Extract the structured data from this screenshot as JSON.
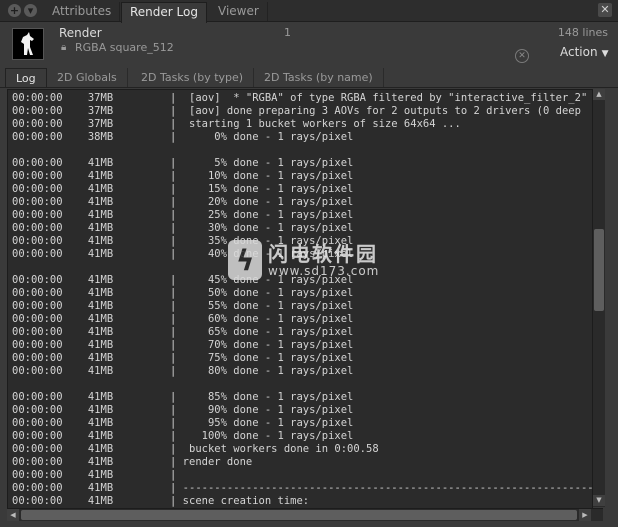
{
  "window": {
    "tabs": [
      {
        "label": "Attributes",
        "active": false
      },
      {
        "label": "Render Log",
        "active": true
      },
      {
        "label": "Viewer",
        "active": false
      }
    ]
  },
  "header": {
    "title": "Render",
    "pass_name": "RGBA  square_512",
    "frame": "1",
    "line_count": "148 lines",
    "action_label": "Action"
  },
  "subtabs": [
    {
      "label": "Log",
      "active": true
    },
    {
      "label": "2D Globals",
      "active": false
    },
    {
      "label": "2D Tasks (by type)",
      "active": false
    },
    {
      "label": "2D Tasks (by name)",
      "active": false
    }
  ],
  "log_lines": [
    "00:00:00    37MB         |  [aov]  * \"RGBA\" of type RGBA filtered by \"interactive_filter_2\"",
    "00:00:00    37MB         |  [aov] done preparing 3 AOVs for 2 outputs to 2 drivers (0 deep",
    "00:00:00    37MB         |  starting 1 bucket workers of size 64x64 ...",
    "00:00:00    38MB         |      0% done - 1 rays/pixel",
    "",
    "00:00:00    41MB         |      5% done - 1 rays/pixel",
    "00:00:00    41MB         |     10% done - 1 rays/pixel",
    "00:00:00    41MB         |     15% done - 1 rays/pixel",
    "00:00:00    41MB         |     20% done - 1 rays/pixel",
    "00:00:00    41MB         |     25% done - 1 rays/pixel",
    "00:00:00    41MB         |     30% done - 1 rays/pixel",
    "00:00:00    41MB         |     35% done - 1 rays/pixel",
    "00:00:00    41MB         |     40% done - 1 rays/pixel",
    "",
    "00:00:00    41MB         |     45% done - 1 rays/pixel",
    "00:00:00    41MB         |     50% done - 1 rays/pixel",
    "00:00:00    41MB         |     55% done - 1 rays/pixel",
    "00:00:00    41MB         |     60% done - 1 rays/pixel",
    "00:00:00    41MB         |     65% done - 1 rays/pixel",
    "00:00:00    41MB         |     70% done - 1 rays/pixel",
    "00:00:00    41MB         |     75% done - 1 rays/pixel",
    "00:00:00    41MB         |     80% done - 1 rays/pixel",
    "",
    "00:00:00    41MB         |     85% done - 1 rays/pixel",
    "00:00:00    41MB         |     90% done - 1 rays/pixel",
    "00:00:00    41MB         |     95% done - 1 rays/pixel",
    "00:00:00    41MB         |    100% done - 1 rays/pixel",
    "00:00:00    41MB         |  bucket workers done in 0:00.58",
    "00:00:00    41MB         | render done",
    "00:00:00    41MB         |",
    "00:00:00    41MB         | --------------------------------------------------------------------",
    "00:00:00    41MB         | scene creation time:"
  ],
  "watermark": {
    "text": "闪电软件园",
    "url": "www.sd173.com"
  },
  "colors": {
    "background": "#3a3a3a",
    "log_background": "#2b2b2b",
    "text": "#d4d4d4"
  },
  "icons": [
    "add-pane-icon",
    "pane-menu-icon",
    "close-icon",
    "lock-icon",
    "clear-icon",
    "dropdown-arrow-icon"
  ]
}
